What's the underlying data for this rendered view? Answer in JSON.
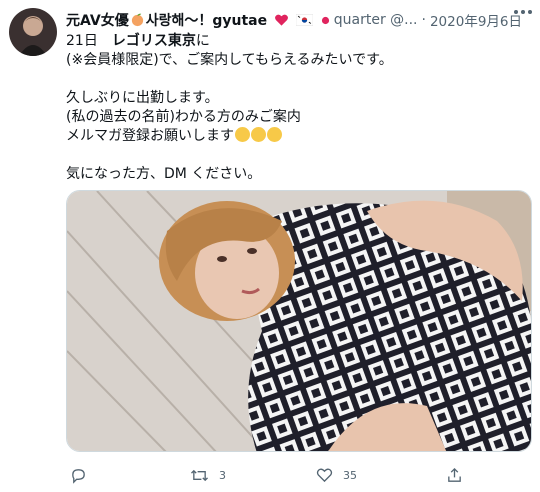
{
  "tweet": {
    "display_name_part1": "元AV女優",
    "display_name_part2": "사랑해〜！gyutae",
    "handle_visible": "quarter @...",
    "separator": "·",
    "date": "2020年9月6日",
    "lines": {
      "l1a": "21日　",
      "l1b": "レゴリス東京",
      "l1c": "に",
      "l2": "(※会員様限定)で、ご案内してもらえるみたいです。",
      "l3": "久しぶりに出勤します。",
      "l4": "(私の過去の名前)わかる方のみご案内",
      "l5": "メルマガ登録お願いします",
      "l6": "気になった方、DM ください。"
    }
  },
  "media": {
    "description_alt": "photo"
  },
  "actions": {
    "reply_count": "",
    "retweet_count": "3",
    "like_count": "35"
  },
  "colors": {
    "text": "#0f1419",
    "muted": "#536471",
    "border": "#cfd9de",
    "heart_red": "#e0245e"
  }
}
